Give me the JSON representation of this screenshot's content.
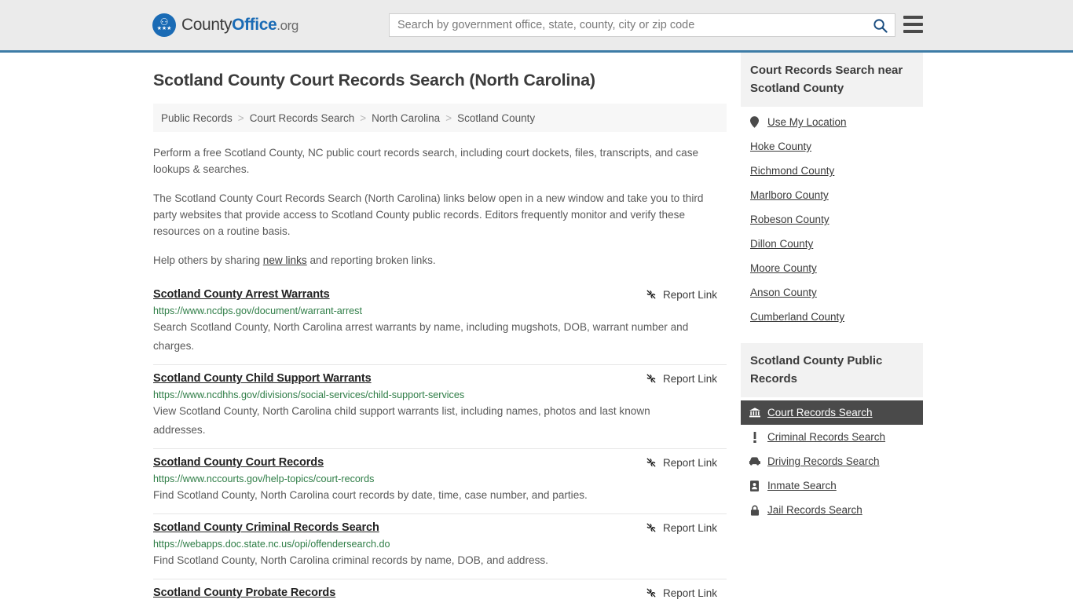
{
  "header": {
    "logo": {
      "part1": "County",
      "part2": "Office",
      "part3": ".org",
      "eagle": "⚇",
      "stars": "★★★"
    },
    "search": {
      "value": "",
      "placeholder": "Search by government office, state, county, city or zip code"
    },
    "search_icon_name": "search-icon",
    "menu_icon_name": "hamburger-menu-icon",
    "accent_color": "#3d7ca6",
    "bg_color": "#ebebeb"
  },
  "page": {
    "title": "Scotland County Court Records Search (North Carolina)"
  },
  "breadcrumb": {
    "separator": ">",
    "items": [
      {
        "label": "Public Records"
      },
      {
        "label": "Court Records Search"
      },
      {
        "label": "North Carolina"
      },
      {
        "label": "Scotland County"
      }
    ]
  },
  "intro": {
    "p1": "Perform a free Scotland County, NC public court records search, including court dockets, files, transcripts, and case lookups & searches.",
    "p2": "The Scotland County Court Records Search (North Carolina) links below open in a new window and take you to third party websites that provide access to Scotland County public records. Editors frequently monitor and verify these resources on a routine basis.",
    "p3_before": "Help others by sharing ",
    "p3_link": "new links",
    "p3_after": " and reporting broken links."
  },
  "results": {
    "report_label": "Report Link",
    "report_icon_name": "broken-link-icon",
    "items": [
      {
        "title": "Scotland County Arrest Warrants",
        "url": "https://www.ncdps.gov/document/warrant-arrest",
        "description": "Search Scotland County, North Carolina arrest warrants by name, including mugshots, DOB, warrant number and charges."
      },
      {
        "title": "Scotland County Child Support Warrants",
        "url": "https://www.ncdhhs.gov/divisions/social-services/child-support-services",
        "description": "View Scotland County, North Carolina child support warrants list, including names, photos and last known addresses."
      },
      {
        "title": "Scotland County Court Records",
        "url": "https://www.nccourts.gov/help-topics/court-records",
        "description": "Find Scotland County, North Carolina court records by date, time, case number, and parties."
      },
      {
        "title": "Scotland County Criminal Records Search",
        "url": "https://webapps.doc.state.nc.us/opi/offendersearch.do",
        "description": "Find Scotland County, North Carolina criminal records by name, DOB, and address."
      },
      {
        "title": "Scotland County Probate Records",
        "url": "",
        "description": ""
      }
    ]
  },
  "sidebar": {
    "nearby": {
      "heading": "Court Records Search near Scotland County",
      "items": [
        {
          "label": "Use My Location",
          "icon": "map-pin-icon",
          "has_icon": true
        },
        {
          "label": "Hoke County",
          "icon": "",
          "has_icon": false
        },
        {
          "label": "Richmond County",
          "icon": "",
          "has_icon": false
        },
        {
          "label": "Marlboro County",
          "icon": "",
          "has_icon": false
        },
        {
          "label": "Robeson County",
          "icon": "",
          "has_icon": false
        },
        {
          "label": "Dillon County",
          "icon": "",
          "has_icon": false
        },
        {
          "label": "Moore County",
          "icon": "",
          "has_icon": false
        },
        {
          "label": "Anson County",
          "icon": "",
          "has_icon": false
        },
        {
          "label": "Cumberland County",
          "icon": "",
          "has_icon": false
        }
      ]
    },
    "public_records": {
      "heading": "Scotland County Public Records",
      "items": [
        {
          "label": "Court Records Search",
          "icon": "courthouse-icon",
          "active": true
        },
        {
          "label": "Criminal Records Search",
          "icon": "exclamation-icon",
          "active": false
        },
        {
          "label": "Driving Records Search",
          "icon": "car-icon",
          "active": false
        },
        {
          "label": "Inmate Search",
          "icon": "id-badge-icon",
          "active": false
        },
        {
          "label": "Jail Records Search",
          "icon": "padlock-icon",
          "active": false
        }
      ],
      "active_bg": "#4a4a4a"
    }
  }
}
